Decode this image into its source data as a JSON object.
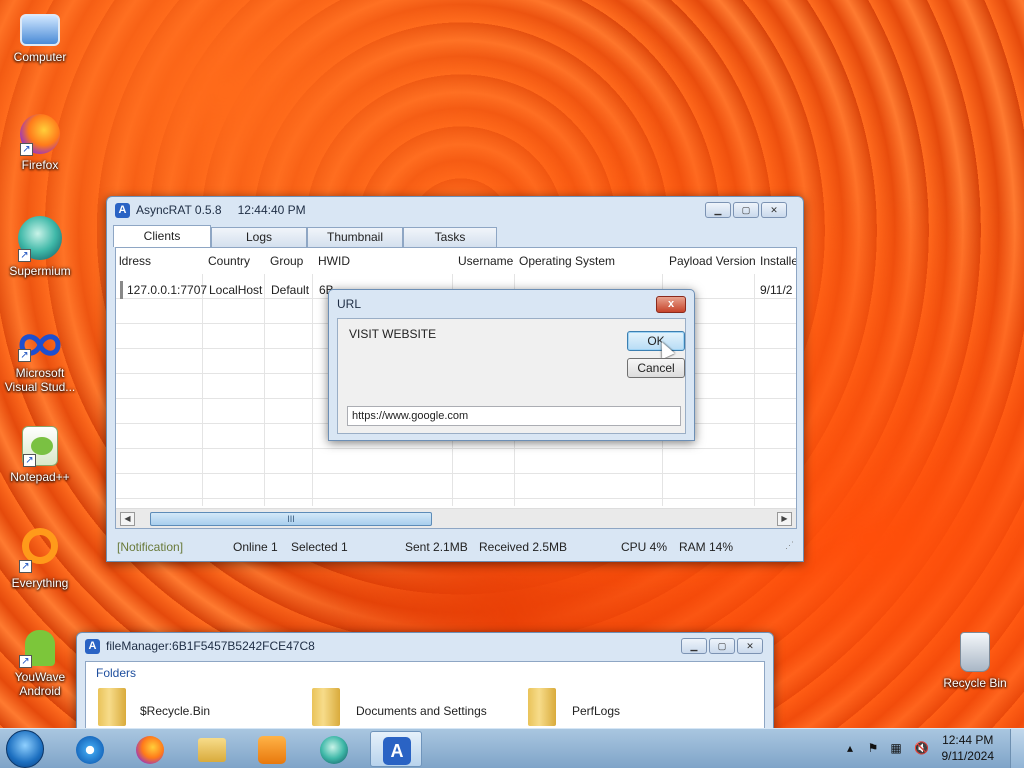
{
  "desktop_icons": [
    {
      "label": "Computer",
      "icon": "computer-icon"
    },
    {
      "label": "Firefox",
      "icon": "firefox-icon"
    },
    {
      "label": "Supermium",
      "icon": "supermium-icon"
    },
    {
      "label": "Microsoft Visual Stud...",
      "icon": "visual-studio-icon"
    },
    {
      "label": "Notepad++",
      "icon": "notepadpp-icon"
    },
    {
      "label": "Everything",
      "icon": "everything-icon"
    },
    {
      "label": "YouWave Android",
      "icon": "android-icon"
    },
    {
      "label": "Recycle Bin",
      "icon": "recycle-bin-icon"
    }
  ],
  "rat_window": {
    "title": "AsyncRAT 0.5.8",
    "time": "12:44:40 PM",
    "tabs": [
      "Clients",
      "Logs",
      "Thumbnail",
      "Tasks"
    ],
    "columns": [
      "ldress",
      "Country",
      "Group",
      "HWID",
      "Username",
      "Operating System",
      "Payload Version",
      "Installe"
    ],
    "row": [
      "127.0.0.1:7707",
      "LocalHost",
      "Default",
      "6B",
      "",
      "",
      "",
      "9/11/2"
    ],
    "scroll_grip": "III",
    "status": {
      "notification": "[Notification]",
      "online": "Online 1",
      "selected": "Selected 1",
      "sent": "Sent 2.1MB",
      "received": "Received 2.5MB",
      "cpu": "CPU 4%",
      "ram": "RAM 14%"
    }
  },
  "url_dialog": {
    "title": "URL",
    "prompt": "VISIT WEBSITE",
    "ok": "OK",
    "cancel": "Cancel",
    "url_value": "https://www.google.com",
    "close": "x"
  },
  "file_manager": {
    "title": "fileManager:6B1F5457B5242FCE47C8",
    "section": "Folders",
    "folders": [
      "$Recycle.Bin",
      "Documents and Settings",
      "PerfLogs"
    ]
  },
  "taskbar": {
    "apps": [
      "ie-icon",
      "firefox-icon",
      "explorer-icon",
      "media-player-icon",
      "supermium-icon",
      "asyncrat-icon"
    ],
    "time": "12:44 PM",
    "date": "9/11/2024"
  }
}
